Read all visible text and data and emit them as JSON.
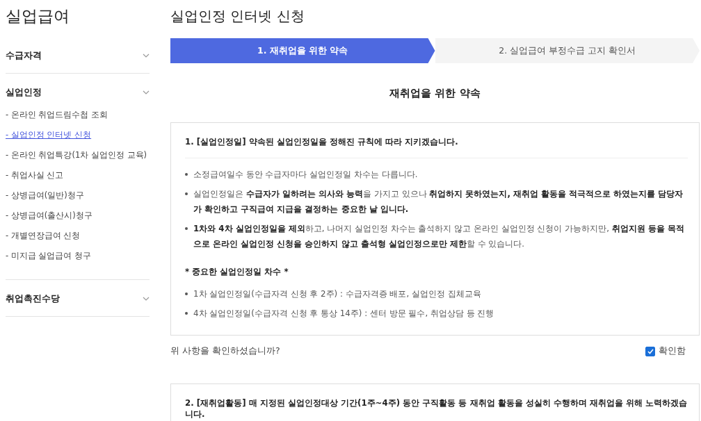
{
  "sidebar": {
    "title": "실업급여",
    "sections": [
      {
        "label": "수급자격"
      },
      {
        "label": "실업인정",
        "items": [
          {
            "label": "- 온라인 취업드림수첩 조회",
            "selected": false
          },
          {
            "label": "- 실업인정 인터넷 신청",
            "selected": true
          },
          {
            "label": "- 온라인 취업특강(1차 실업인정 교육)",
            "selected": false
          },
          {
            "label": "- 취업사실 신고",
            "selected": false
          },
          {
            "label": "- 상병급여(일반)청구",
            "selected": false
          },
          {
            "label": "- 상병급여(출산시)청구",
            "selected": false
          },
          {
            "label": "- 개별연장급여 신청",
            "selected": false
          },
          {
            "label": "- 미지급 실업급여 청구",
            "selected": false
          }
        ]
      },
      {
        "label": "취업촉진수당"
      }
    ]
  },
  "page_title": "실업인정 인터넷 신청",
  "steps": [
    {
      "label": "1. 재취업을 위한 약속",
      "selected": true
    },
    {
      "label": "2. 실업급여 부정수급 고지 확인서",
      "selected": false
    }
  ],
  "section_title": "재취업을 위한 약속",
  "pledges": [
    {
      "heading": "1. [실업인정일] 약속된 실업인정일을 정해진 규칙에 따라 지키겠습니다.",
      "bullets": [
        "소정급여일수 동안 수급자마다 실업인정일 차수는 다릅니다.",
        "실업인정일은 **수급자가 일하려는 의사와 능력**을 가지고 있으나 **취업하지 못하였는지, 재취업 활동을 적극적으로 하였는지를 담당자가 확인하고 구직급여 지급을 결정하는 중요한 날 입니다.**",
        "**1차와 4차 실업인정일을 제외**하고, 나머지 실업인정 차수는 출석하지 않고 온라인 실업인정 신청이 가능하지만, **취업지원 등을 목적으로 온라인 실업인정 신청을 승인하지 않고 출석형 실업인정으로만 제한**할 수 있습니다."
      ],
      "note_title": "* 중요한 실업인정일 차수 *",
      "notes": [
        "1차 실업인정일(수급자격 신청 후 2주) : 수급자격증 배포, 실업인정 집체교육",
        "4차 실업인정일(수급자격 신청 후 통상 14주) : 센터 방문 필수, 취업상담 등 진행"
      ],
      "confirm_question": "위 사항을 확인하셨습니까?",
      "confirm_label": "확인함",
      "confirmed": true
    },
    {
      "heading": "2. [재취업활동] 매 지정된 실업인정대상 기간(1주~4주) 동안 구직활동 등 재취업 활동을 성실히 수행하며 재취업을 위해 노력하겠습니다."
    }
  ]
}
